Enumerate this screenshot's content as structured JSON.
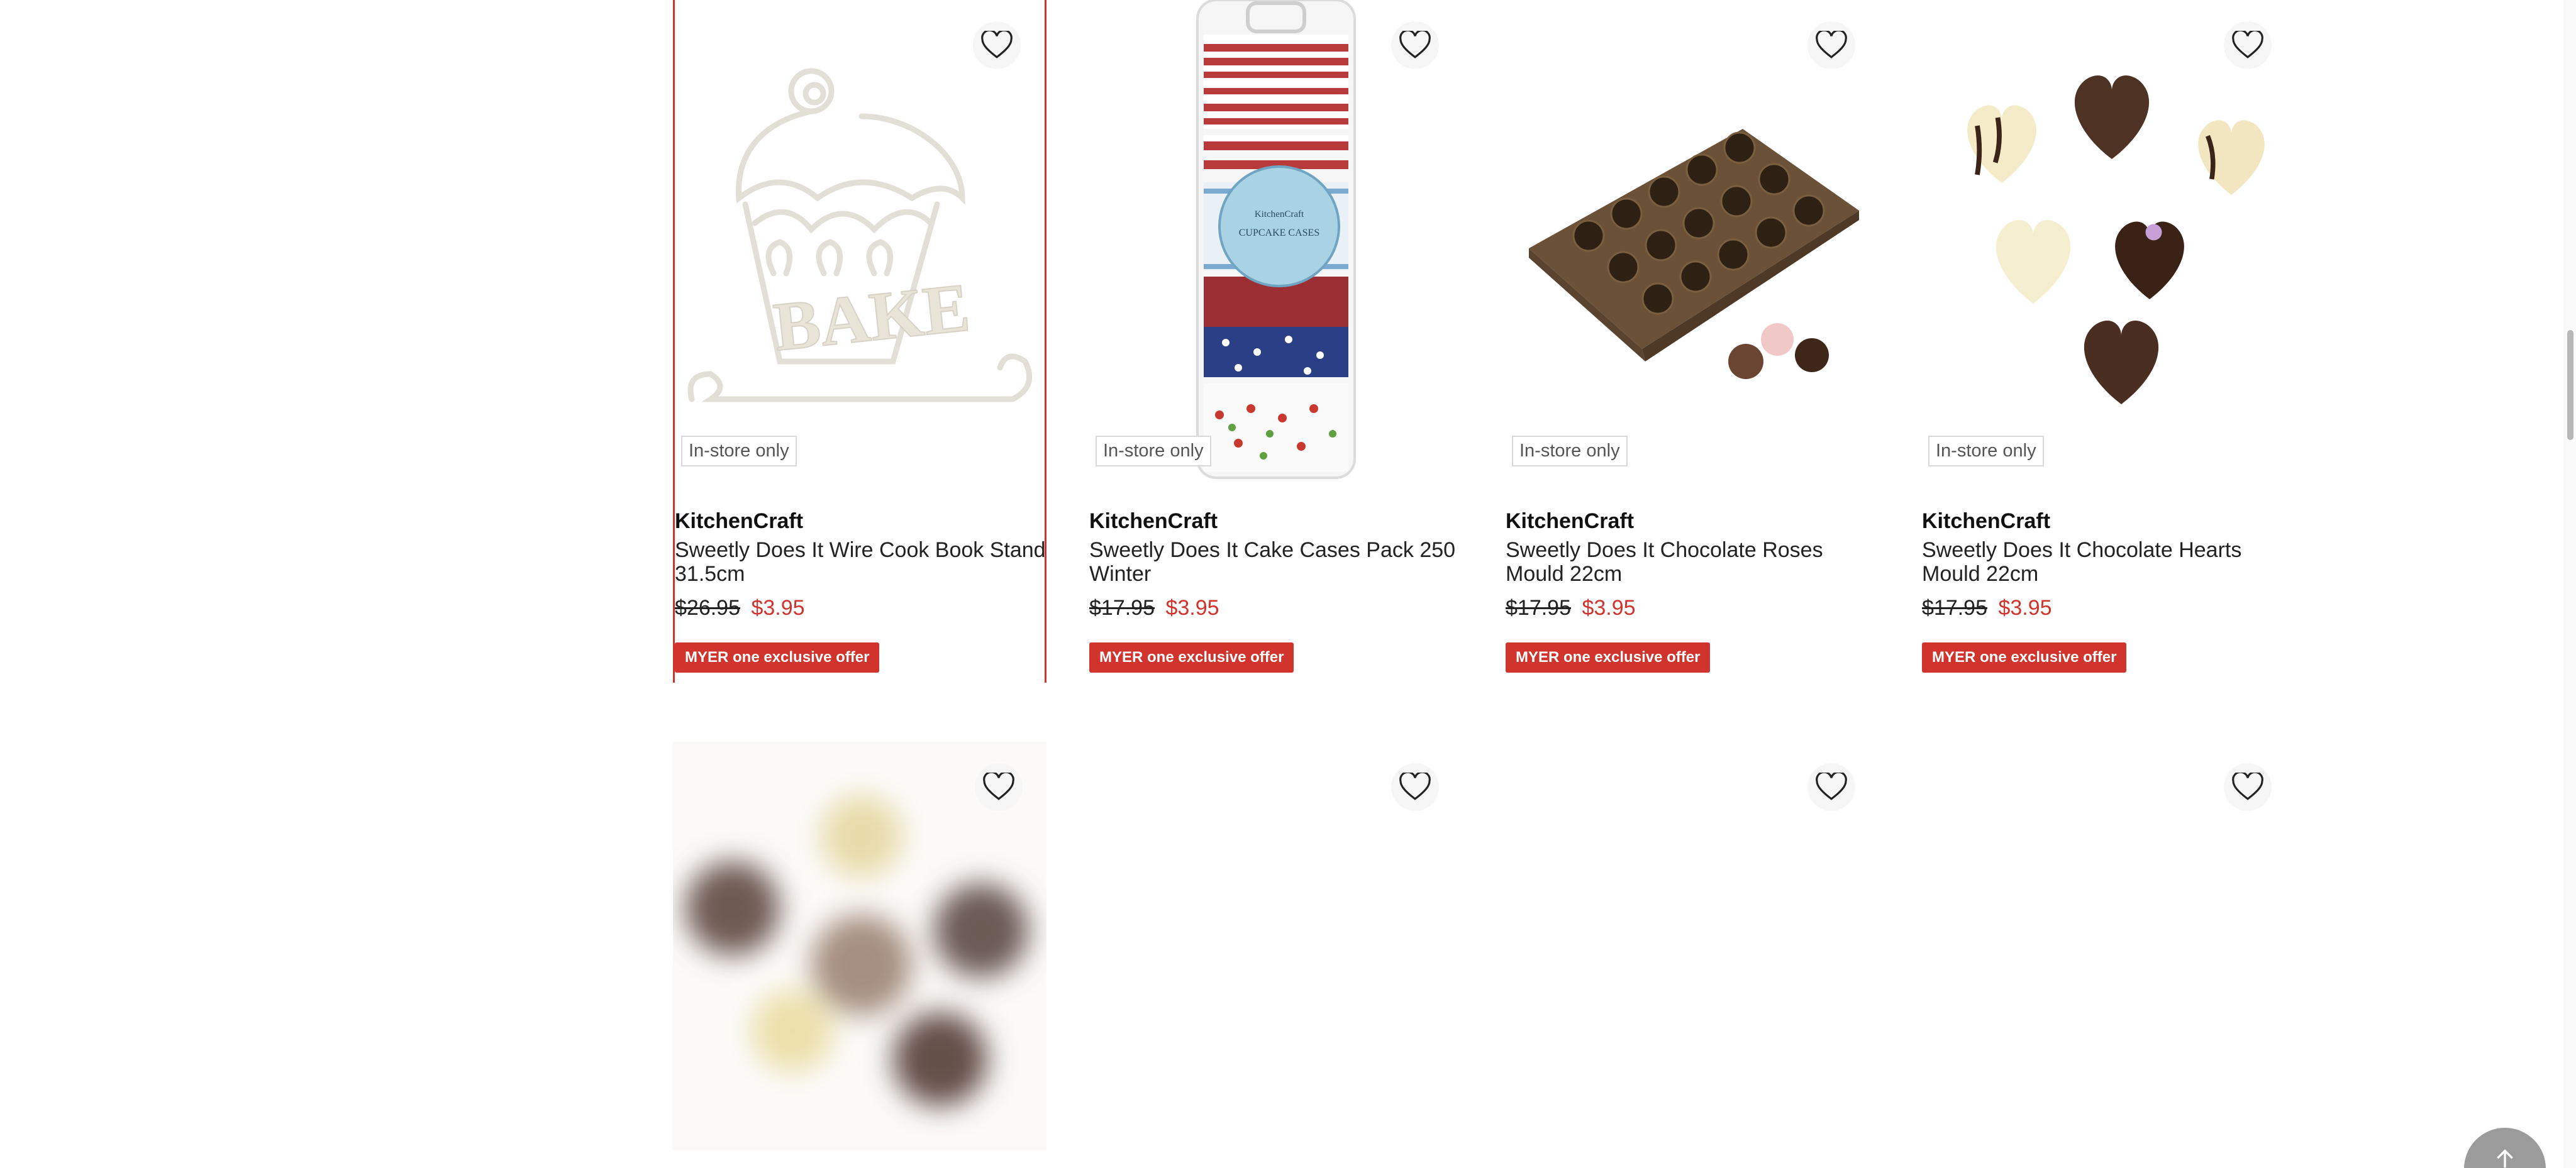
{
  "products_row1": [
    {
      "brand": "KitchenCraft",
      "title": "Sweetly Does It Wire Cook Book Stand 31.5cm",
      "old_price": "$26.95",
      "new_price": "$3.95",
      "instore": "In-store only",
      "offer": "MYER one exclusive offer",
      "image_icon": "cook-book-stand-image"
    },
    {
      "brand": "KitchenCraft",
      "title": "Sweetly Does It Cake Cases Pack 250 Winter",
      "old_price": "$17.95",
      "new_price": "$3.95",
      "instore": "In-store only",
      "offer": "MYER one exclusive offer",
      "image_icon": "cake-cases-image"
    },
    {
      "brand": "KitchenCraft",
      "title": "Sweetly Does It Chocolate Roses Mould 22cm",
      "old_price": "$17.95",
      "new_price": "$3.95",
      "instore": "In-store only",
      "offer": "MYER one exclusive offer",
      "image_icon": "roses-mould-image"
    },
    {
      "brand": "KitchenCraft",
      "title": "Sweetly Does It Chocolate Hearts Mould 22cm",
      "old_price": "$17.95",
      "new_price": "$3.95",
      "instore": "In-store only",
      "offer": "MYER one exclusive offer",
      "image_icon": "hearts-mould-image"
    }
  ],
  "colors": {
    "accent": "#d0342c",
    "bg": "#ffffff"
  }
}
